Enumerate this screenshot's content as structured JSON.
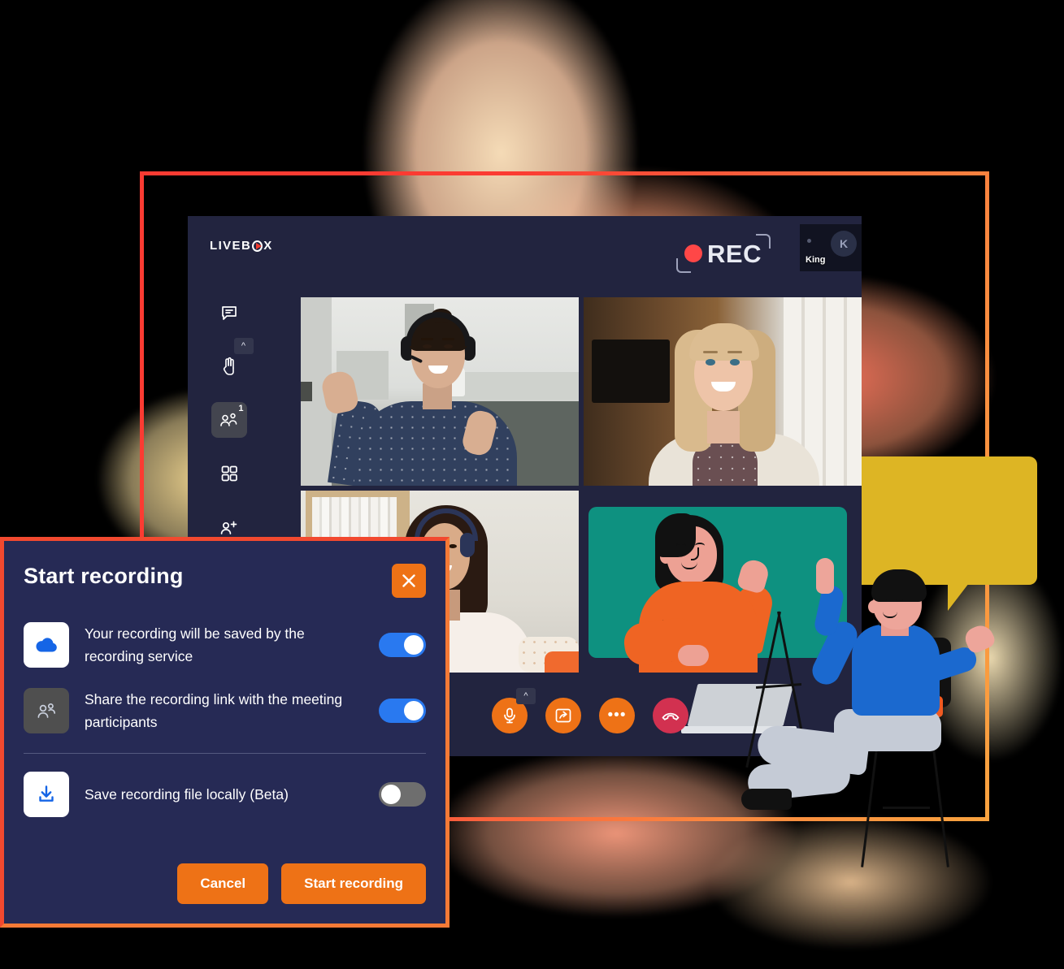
{
  "app": {
    "logo_text_before": "LIVEB",
    "logo_letter_o": "O",
    "logo_text_after": "X",
    "logo_full": "LIVEBOX"
  },
  "recording_indicator": {
    "label": "REC",
    "dot_color": "#ff4747",
    "bracket_color": "#9ea2bb"
  },
  "self_tile": {
    "name": "King",
    "avatar_initial": "K"
  },
  "sidebar": {
    "items": [
      {
        "name": "chat",
        "icon": "chat-bubble-icon",
        "badge": "",
        "active": false
      },
      {
        "name": "raise-hand",
        "icon": "raise-hand-icon",
        "badge": "",
        "active": false,
        "chevron": "^"
      },
      {
        "name": "participants",
        "icon": "participants-icon",
        "badge": "1",
        "active": true
      },
      {
        "name": "layout",
        "icon": "grid-layout-icon",
        "badge": "",
        "active": false
      },
      {
        "name": "add-participant",
        "icon": "add-person-icon",
        "badge": "",
        "active": false
      }
    ]
  },
  "controls": [
    {
      "name": "microphone",
      "icon": "microphone-icon",
      "color": "#ee7216",
      "chevron": "^"
    },
    {
      "name": "share-screen",
      "icon": "share-screen-icon",
      "color": "#ee7216"
    },
    {
      "name": "more-options",
      "icon": "more-options-icon",
      "label": "•••",
      "color": "#ee7216"
    },
    {
      "name": "end-call",
      "icon": "phone-hangup-icon",
      "color": "#d23150"
    }
  ],
  "dialog": {
    "title": "Start recording",
    "close_label": "×",
    "options": [
      {
        "id": "cloud-recording",
        "icon": "cloud-icon",
        "label": "Your recording will be saved by the recording service",
        "toggle_state": "on",
        "tile_style": "white"
      },
      {
        "id": "share-link",
        "icon": "participants-icon",
        "label": "Share the recording link with the meeting participants",
        "toggle_state": "on",
        "tile_style": "gray"
      },
      {
        "id": "save-locally",
        "icon": "download-icon",
        "label": "Save recording file locally (Beta)",
        "toggle_state": "off",
        "tile_style": "white"
      }
    ],
    "cancel_label": "Cancel",
    "confirm_label": "Start recording"
  },
  "colors": {
    "accent_orange": "#ee7216",
    "dialog_bg": "#262a55",
    "app_bg": "#22243f",
    "toggle_on": "#2979f0",
    "toggle_off": "#6e6e6e",
    "end_call_red": "#d23150",
    "frame_red": "#f2492f",
    "teal": "#0e9180",
    "bubble_yellow": "#ddb524"
  }
}
